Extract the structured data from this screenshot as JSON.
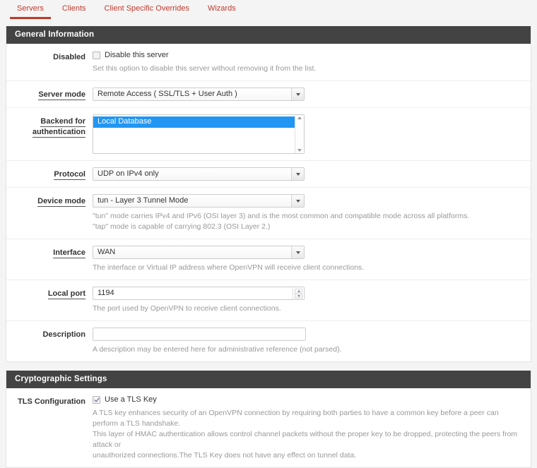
{
  "tabs": [
    {
      "label": "Servers",
      "active": true
    },
    {
      "label": "Clients",
      "active": false
    },
    {
      "label": "Client Specific Overrides",
      "active": false
    },
    {
      "label": "Wizards",
      "active": false
    }
  ],
  "colors": {
    "accent": "#c0392b",
    "panel_header_bg": "#434343",
    "selection_blue": "#2196f3",
    "page_bg": "#f4f4f4",
    "help_text": "#999999"
  },
  "sections": {
    "general": {
      "title": "General Information",
      "disabled": {
        "label": "Disabled",
        "checkbox_label": "Disable this server",
        "checked": false,
        "help": "Set this option to disable this server without removing it from the list."
      },
      "server_mode": {
        "label": "Server mode",
        "value": "Remote Access ( SSL/TLS + User Auth )"
      },
      "backend_auth": {
        "label_line1": "Backend for",
        "label_line2": "authentication",
        "options": [
          "Local Database"
        ],
        "selected": "Local Database"
      },
      "protocol": {
        "label": "Protocol",
        "value": "UDP on IPv4 only"
      },
      "device_mode": {
        "label": "Device mode",
        "value": "tun - Layer 3 Tunnel Mode",
        "help_line1": "\"tun\" mode carries IPv4 and IPv6 (OSI layer 3) and is the most common and compatible mode across all platforms.",
        "help_line2": "\"tap\" mode is capable of carrying 802.3 (OSI Layer 2.)"
      },
      "interface": {
        "label": "Interface",
        "value": "WAN",
        "help": "The interface or Virtual IP address where OpenVPN will receive client connections."
      },
      "local_port": {
        "label": "Local port",
        "value": "1194",
        "help": "The port used by OpenVPN to receive client connections."
      },
      "description": {
        "label": "Description",
        "value": "",
        "placeholder": "",
        "help": "A description may be entered here for administrative reference (not parsed)."
      }
    },
    "crypto": {
      "title": "Cryptographic Settings",
      "tls_configuration": {
        "label": "TLS Configuration",
        "checkbox_label": "Use a TLS Key",
        "checked": true,
        "help_line1": "A TLS key enhances security of an OpenVPN connection by requiring both parties to have a common key before a peer can perform a TLS handshake.",
        "help_line2": "This layer of HMAC authentication allows control channel packets without the proper key to be dropped, protecting the peers from attack or",
        "help_line3": "unauthorized connections.The TLS Key does not have any effect on tunnel data."
      }
    }
  }
}
